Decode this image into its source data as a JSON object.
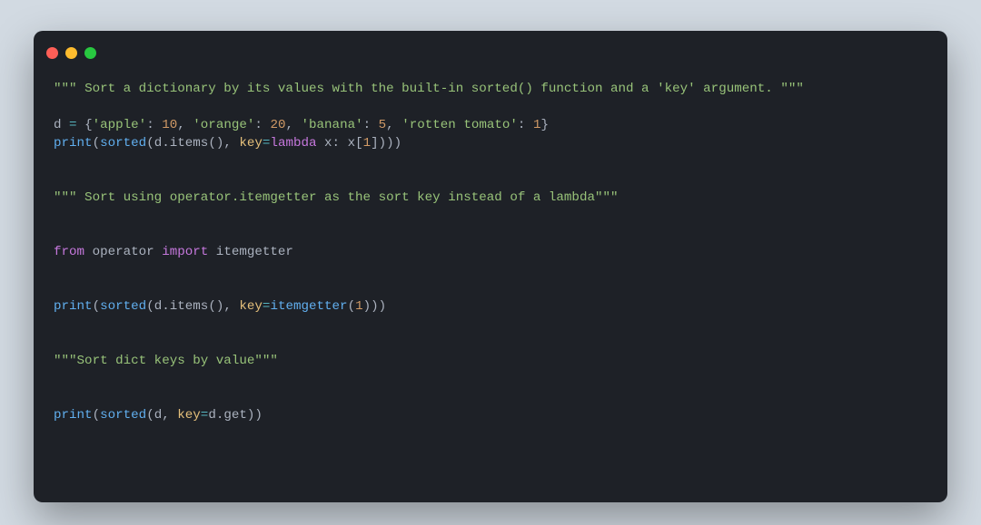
{
  "dots": {
    "red": "#ff5f57",
    "yellow": "#febc2e",
    "green": "#28c840"
  },
  "code": {
    "doc1_open": "\"\"\" ",
    "doc1_body": "Sort a dictionary by its values with the built-in sorted() function and a 'key' argument. ",
    "doc1_close": "\"\"\"",
    "assign_d": "d ",
    "eq": "= ",
    "brace_o": "{",
    "k1": "'apple'",
    "colon": ": ",
    "v1": "10",
    "comma": ", ",
    "k2": "'orange'",
    "v2": "20",
    "k3": "'banana'",
    "v3": "5",
    "k4": "'rotten tomato'",
    "v4": "1",
    "brace_c": "}",
    "print_": "print",
    "sorted_": "sorted",
    "lpar": "(",
    "rpar": ")",
    "d_items": "d.items",
    "d_only": "d",
    "key_eq": "key",
    "lambda_": "lambda",
    "x_colon": " x: x[",
    "idx1": "1",
    "rbrack": "]",
    "rparrpar": "))",
    "rparrparrpar": ")))",
    "doc2": "\"\"\" Sort using operator.itemgetter as the sort key instead of a lambda\"\"\"",
    "from_": "from",
    "operator_": " operator ",
    "import_": "import",
    "itemgetter_": " itemgetter",
    "itemgetter_call": "itemgetter",
    "doc3": "\"\"\"Sort dict keys by value\"\"\"",
    "d_get": "d.get"
  }
}
